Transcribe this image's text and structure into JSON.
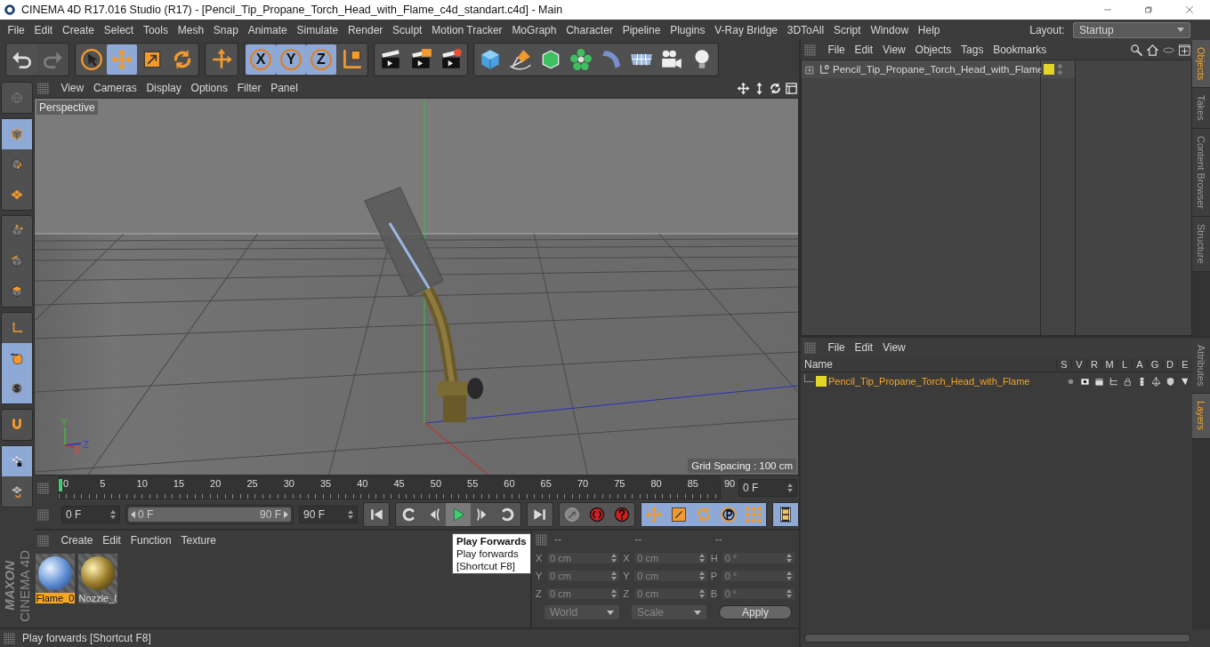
{
  "window": {
    "title": "CINEMA 4D R17.016 Studio (R17) - [Pencil_Tip_Propane_Torch_Head_with_Flame_c4d_standart.c4d] - Main"
  },
  "menu": [
    "File",
    "Edit",
    "Create",
    "Select",
    "Tools",
    "Mesh",
    "Snap",
    "Animate",
    "Simulate",
    "Render",
    "Sculpt",
    "Motion Tracker",
    "MoGraph",
    "Character",
    "Pipeline",
    "Plugins",
    "V-Ray Bridge",
    "3DToAll",
    "Script",
    "Window",
    "Help"
  ],
  "layout": {
    "label": "Layout:",
    "value": "Startup"
  },
  "toolbar": [
    [
      {
        "kind": "undo",
        "disabled": false
      },
      {
        "kind": "redo",
        "disabled": true
      }
    ],
    [
      {
        "kind": "pointer",
        "selected": false
      },
      {
        "kind": "move",
        "selected": true
      },
      {
        "kind": "scale",
        "selected": false
      },
      {
        "kind": "rotate",
        "selected": false
      }
    ],
    [
      {
        "kind": "add",
        "selected": false
      }
    ],
    [
      {
        "kind": "axis",
        "label": "X",
        "selected": true
      },
      {
        "kind": "axis",
        "label": "Y",
        "selected": true
      },
      {
        "kind": "axis",
        "label": "Z",
        "selected": true
      },
      {
        "kind": "coords",
        "selected": false
      }
    ],
    [
      {
        "kind": "render_view",
        "selected": false
      },
      {
        "kind": "render_region",
        "selected": false
      },
      {
        "kind": "render_settings",
        "selected": false
      }
    ],
    [
      {
        "kind": "cube",
        "selected": false
      },
      {
        "kind": "pen",
        "selected": false
      },
      {
        "kind": "subdiv",
        "selected": false
      },
      {
        "kind": "array",
        "selected": false
      },
      {
        "kind": "deformer",
        "selected": false
      },
      {
        "kind": "floor",
        "selected": false
      },
      {
        "kind": "camera",
        "selected": false
      },
      {
        "kind": "light",
        "selected": false
      }
    ]
  ],
  "tools": [
    [
      {
        "kind": "globe",
        "selected": false
      }
    ],
    [
      {
        "kind": "model",
        "selected": true
      },
      {
        "kind": "texture",
        "selected": false
      },
      {
        "kind": "workplane",
        "selected": false
      }
    ],
    [
      {
        "kind": "points",
        "selected": false
      },
      {
        "kind": "edges",
        "selected": false
      },
      {
        "kind": "polygons",
        "selected": false
      }
    ],
    [
      {
        "kind": "axis_tool",
        "selected": false
      },
      {
        "kind": "tweak",
        "selected": true
      },
      {
        "kind": "snap",
        "selected": true
      }
    ],
    [
      {
        "kind": "magnet",
        "selected": false
      }
    ],
    [
      {
        "kind": "lock_grid",
        "selected": true
      },
      {
        "kind": "snap_grid",
        "selected": false
      }
    ]
  ],
  "viewport": {
    "menu": [
      "View",
      "Cameras",
      "Display",
      "Options",
      "Filter",
      "Panel"
    ],
    "camera": "Perspective",
    "grid_spacing": "Grid Spacing : 100 cm",
    "axis_labels": [
      "Y",
      "X",
      "Z"
    ]
  },
  "timeline": {
    "ticks": [
      "0",
      "5",
      "10",
      "15",
      "20",
      "25",
      "30",
      "35",
      "40",
      "45",
      "50",
      "55",
      "60",
      "65",
      "70",
      "75",
      "80",
      "85",
      "90"
    ],
    "current": "0 F",
    "start": "0 F",
    "range": {
      "start": "0 F",
      "end": "90 F",
      "level": 1
    },
    "end": "90 F",
    "buttons": [
      [
        {
          "kind": "first",
          "selected": false
        }
      ],
      [
        {
          "kind": "prev_key",
          "selected": false
        },
        {
          "kind": "prev_frame",
          "selected": false
        },
        {
          "kind": "play",
          "selected": true
        },
        {
          "kind": "next_frame",
          "selected": false
        },
        {
          "kind": "next_key",
          "selected": false
        }
      ],
      [
        {
          "kind": "last",
          "selected": false
        }
      ],
      [
        {
          "kind": "record",
          "selected": false
        },
        {
          "kind": "autokey",
          "selected": false
        },
        {
          "kind": "keysel",
          "selected": false
        }
      ],
      [
        {
          "kind": "k_move",
          "selected": true
        },
        {
          "kind": "k_scale",
          "selected": true
        },
        {
          "kind": "k_rotate",
          "selected": true
        },
        {
          "kind": "k_param",
          "selected": true
        },
        {
          "kind": "k_pla",
          "selected": true
        }
      ],
      [
        {
          "kind": "film",
          "selected": true
        }
      ]
    ],
    "tooltip": {
      "title": "Play Forwards",
      "lines": [
        "Play forwards",
        "[Shortcut F8]"
      ]
    }
  },
  "materials": {
    "menu": [
      "Create",
      "Edit",
      "Function",
      "Texture"
    ],
    "items": [
      {
        "name": "Flame_0",
        "kind": "glass",
        "selected": true
      },
      {
        "name": "Nozzle_I",
        "kind": "metal",
        "selected": false
      }
    ]
  },
  "coordinates": {
    "headers": [
      "--",
      "--",
      "--"
    ],
    "rows": [
      [
        {
          "axis": "X",
          "value": "0 cm"
        },
        {
          "axis": "X",
          "value": "0 cm"
        },
        {
          "axis": "H",
          "value": "0 °"
        }
      ],
      [
        {
          "axis": "Y",
          "value": "0 cm"
        },
        {
          "axis": "Y",
          "value": "0 cm"
        },
        {
          "axis": "P",
          "value": "0 °"
        }
      ],
      [
        {
          "axis": "Z",
          "value": "0 cm"
        },
        {
          "axis": "Z",
          "value": "0 cm"
        },
        {
          "axis": "B",
          "value": "0 °"
        }
      ]
    ],
    "mode": "World",
    "size_mode": "Scale",
    "apply": "Apply"
  },
  "logo": [
    "MAXON",
    "CINEMA 4D"
  ],
  "status": "Play forwards [Shortcut F8]",
  "objects_panel": {
    "menu": [
      "File",
      "Edit",
      "View",
      "Objects",
      "Tags",
      "Bookmarks"
    ],
    "objects": [
      {
        "name": "Pencil_Tip_Propane_Torch_Head_with_Flame",
        "color": "#e2d62a"
      }
    ]
  },
  "top_tabs": [
    {
      "label": "Objects",
      "selected": true
    },
    {
      "label": "Takes",
      "selected": false
    },
    {
      "label": "Content Browser",
      "selected": false
    },
    {
      "label": "Structure",
      "selected": false
    }
  ],
  "layers_panel": {
    "menu": [
      "File",
      "Edit",
      "View"
    ],
    "columns": [
      "Name",
      "S",
      "V",
      "R",
      "M",
      "L",
      "A",
      "G",
      "D",
      "E"
    ],
    "layers": [
      {
        "name": "Pencil_Tip_Propane_Torch_Head_with_Flame",
        "color": "#e2d62a"
      }
    ]
  },
  "bottom_tabs": [
    {
      "label": "Attributes",
      "selected": false
    },
    {
      "label": "Layers",
      "selected": true
    }
  ]
}
